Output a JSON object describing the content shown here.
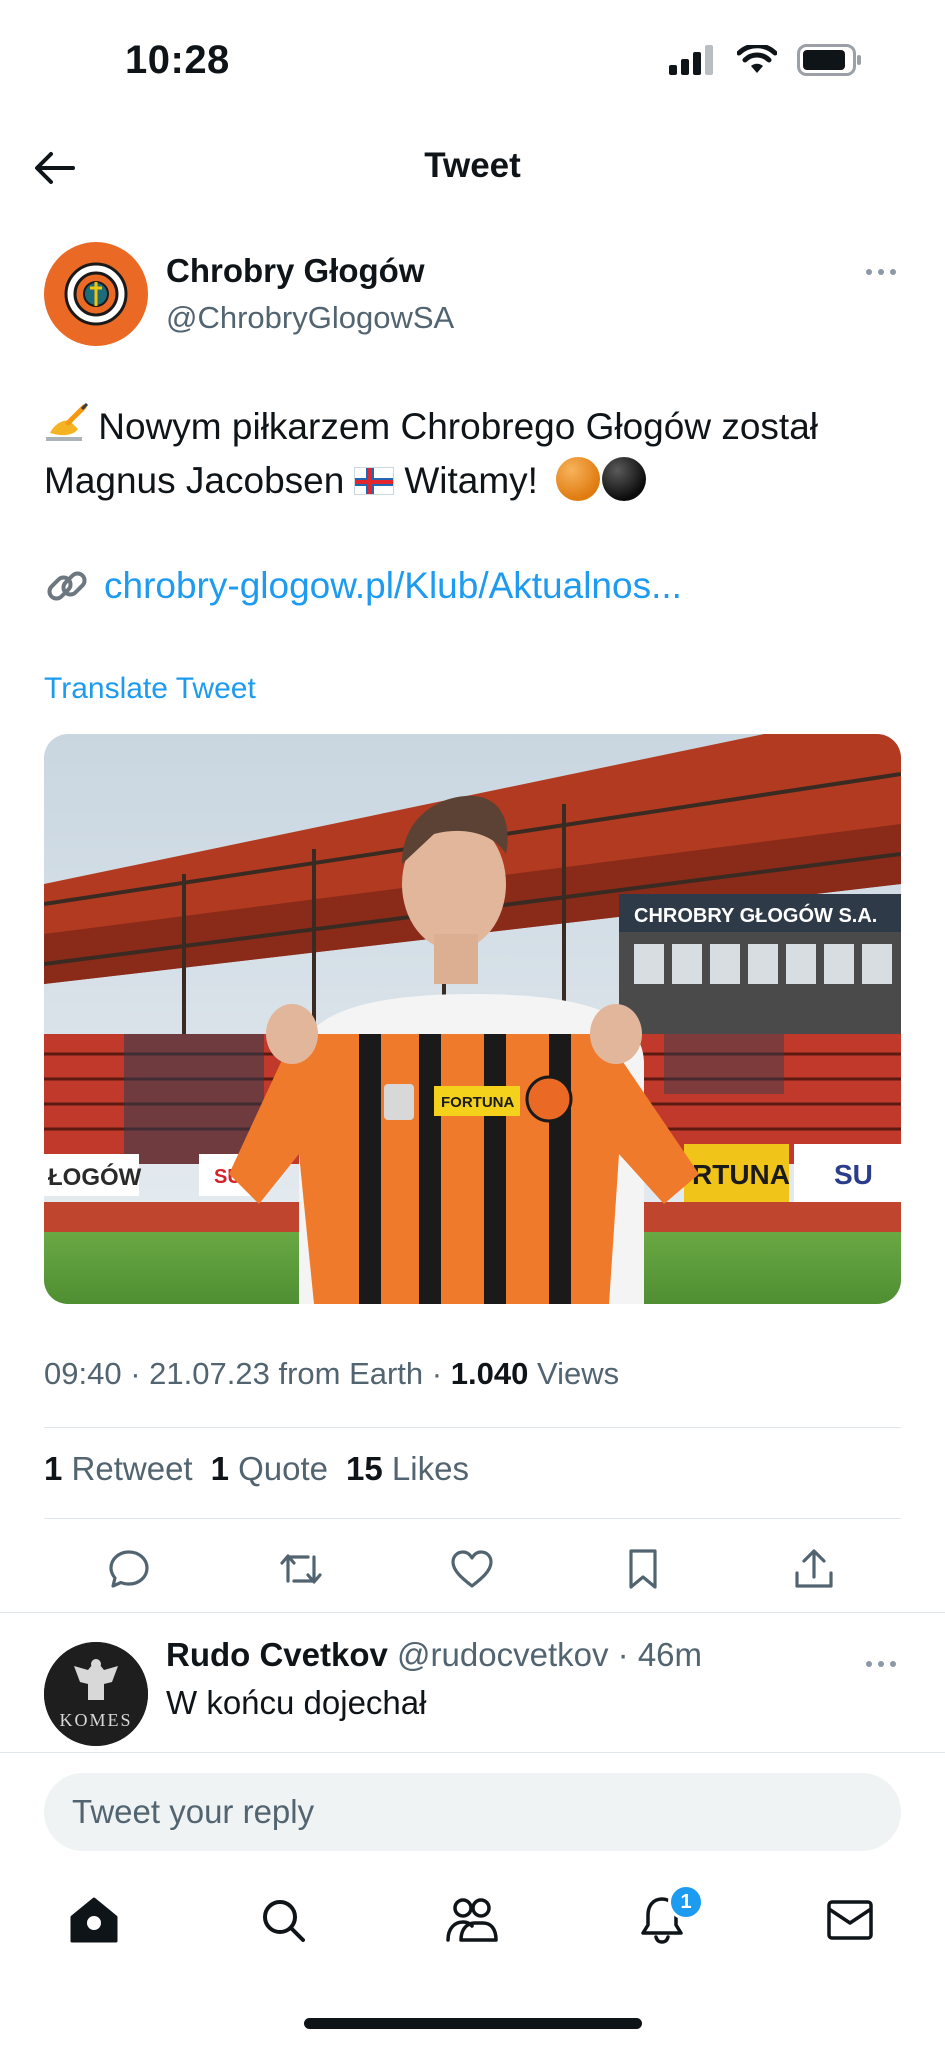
{
  "status_bar": {
    "time": "10:28"
  },
  "header": {
    "title": "Tweet"
  },
  "tweet": {
    "author_name": "Chrobry Głogów",
    "author_handle": "@ChrobryGlogowSA",
    "text_part1": "Nowym piłkarzem Chrobrego Głogów został Magnus Jacobsen",
    "text_part2": "Witamy!",
    "link": "chrobry-glogow.pl/Klub/Aktualnos...",
    "translate": "Translate Tweet",
    "media_signs": {
      "stand": "CHROBRY GŁOGÓW S.A.",
      "left_board": "ŁOGÓW",
      "right_board_1": "RTUNA",
      "right_board_2": "SU",
      "shirt_sponsor": "FORTUNA",
      "small_board": "SU"
    },
    "meta": {
      "time": "09:40",
      "date": "21.07.23",
      "source": "from Earth",
      "views_count": "1.040",
      "views_label": "Views"
    },
    "stats": {
      "retweets_count": "1",
      "retweets_label": "Retweet",
      "quotes_count": "1",
      "quotes_label": "Quote",
      "likes_count": "15",
      "likes_label": "Likes"
    }
  },
  "reply": {
    "name": "Rudo Cvetkov",
    "handle": "@rudocvetkov",
    "time": "· 46m",
    "text": "W końcu dojechał",
    "avatar_text": "KOMES"
  },
  "reply_box": {
    "placeholder": "Tweet your reply"
  },
  "nav": {
    "notifications_badge": "1"
  },
  "colors": {
    "accent": "#1d9bf0",
    "club_orange": "#ea6a25"
  }
}
